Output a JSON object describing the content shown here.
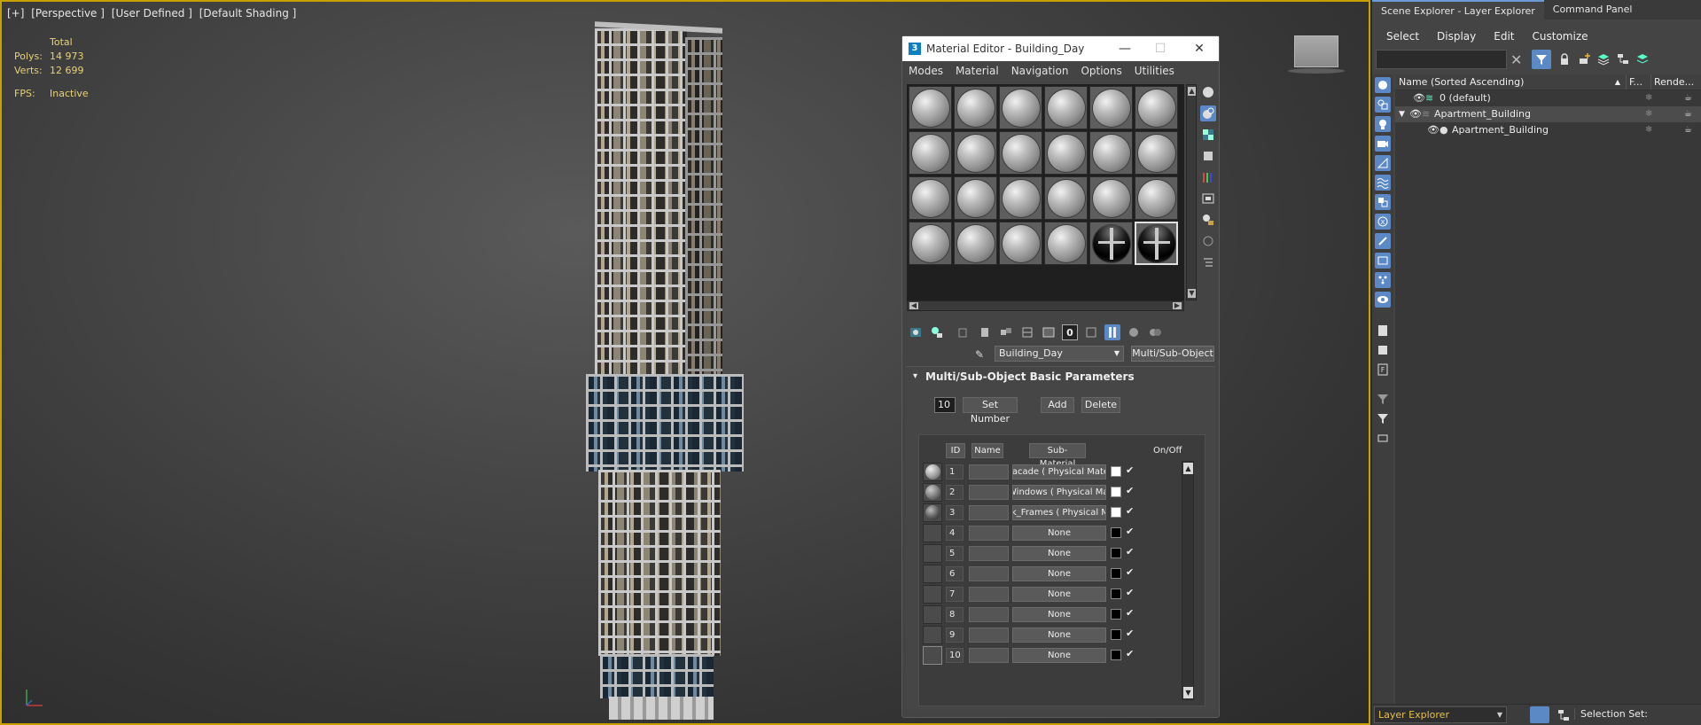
{
  "viewport": {
    "labels": [
      "[+]",
      "[Perspective ]",
      "[User Defined ]",
      "[Default Shading ]"
    ],
    "stats": {
      "total_label": "Total",
      "polys_label": "Polys:",
      "polys": "14 973",
      "verts_label": "Verts:",
      "verts": "12 699",
      "fps_label": "FPS:",
      "fps": "Inactive"
    },
    "nav_cube_icon": "viewcube-icon",
    "axis_icon": "axis-tripod-icon"
  },
  "material_editor": {
    "title": "Material Editor - Building_Day",
    "menu": [
      "Modes",
      "Material",
      "Navigation",
      "Options",
      "Utilities"
    ],
    "material_name": "Building_Day",
    "material_type": "Multi/Sub-Object",
    "rollout_title": "Multi/Sub-Object Basic Parameters",
    "set_number_value": "10",
    "set_number_label": "Set Number",
    "add_label": "Add",
    "delete_label": "Delete",
    "col_id": "ID",
    "col_name": "Name",
    "col_sub": "Sub-Material",
    "col_onoff": "On/Off",
    "rows": [
      {
        "id": "1",
        "sub": "Facade  ( Physical Material )",
        "color": "#ffffff"
      },
      {
        "id": "2",
        "sub": "Windows  ( Physical Material )",
        "color": "#ffffff"
      },
      {
        "id": "3",
        "sub": "k_Frames  ( Physical Material )",
        "color": "#ffffff"
      },
      {
        "id": "4",
        "sub": "None",
        "color": "#000000"
      },
      {
        "id": "5",
        "sub": "None",
        "color": "#000000"
      },
      {
        "id": "6",
        "sub": "None",
        "color": "#000000"
      },
      {
        "id": "7",
        "sub": "None",
        "color": "#000000"
      },
      {
        "id": "8",
        "sub": "None",
        "color": "#000000"
      },
      {
        "id": "9",
        "sub": "None",
        "color": "#000000"
      },
      {
        "id": "10",
        "sub": "None",
        "color": "#000000"
      }
    ]
  },
  "scene_explorer": {
    "tabs": [
      "Scene Explorer - Layer Explorer",
      "Command Panel"
    ],
    "menu": [
      "Select",
      "Display",
      "Edit",
      "Customize"
    ],
    "col_name": "Name (Sorted Ascending)",
    "col_f": "F...",
    "col_render": "Rende...",
    "items": [
      {
        "label": "0 (default)"
      },
      {
        "label": "Apartment_Building"
      },
      {
        "label": "Apartment_Building"
      }
    ],
    "layer_dropdown": "Layer Explorer",
    "selection_set_label": "Selection Set:"
  },
  "colors": {
    "viewport_border": "#c8a000",
    "accent_blue": "#5b89c6",
    "stats_yellow": "#e8d17a"
  }
}
